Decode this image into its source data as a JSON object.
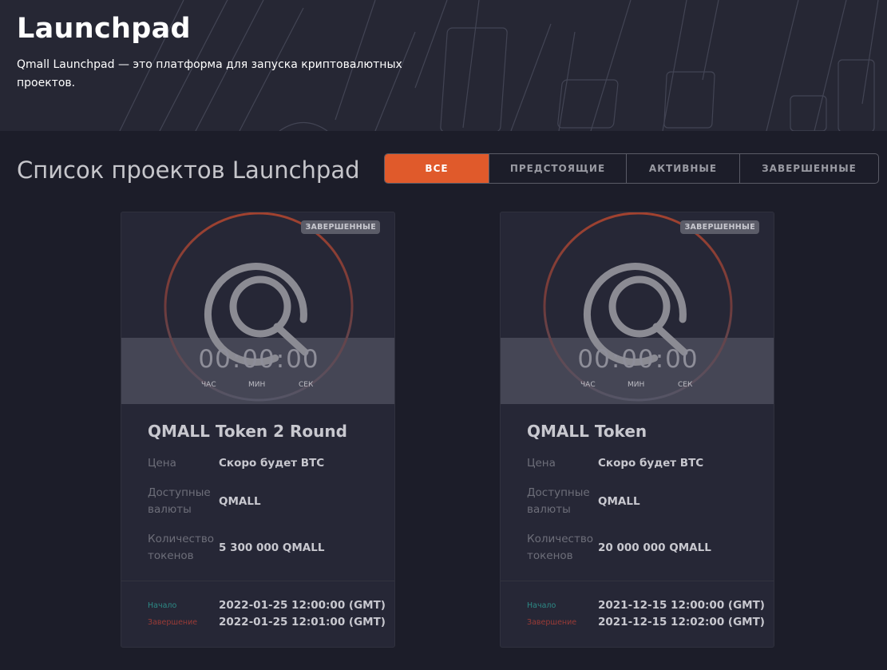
{
  "hero": {
    "title": "Launchpad",
    "subtitle": "Qmall Launchpad — это платформа для запуска криптовалютных проектов."
  },
  "section_title": "Список проектов Launchpad",
  "tabs": [
    {
      "label": "ВСЕ",
      "active": true
    },
    {
      "label": "ПРЕДСТОЯЩИЕ",
      "active": false
    },
    {
      "label": "АКТИВНЫЕ",
      "active": false
    },
    {
      "label": "ЗАВЕРШЕННЫЕ",
      "active": false
    }
  ],
  "colors": {
    "accent": "#e05a2b",
    "background": "#1c1d29",
    "card": "#262736",
    "start_label": "#2d8a86",
    "end_label": "#9a3b36"
  },
  "timer_labels": {
    "hours": "ЧАС",
    "minutes": "МИН",
    "seconds": "СЕК"
  },
  "field_labels": {
    "price": "Цена",
    "currencies": "Доступные валюты",
    "token_amount": "Количество токенов",
    "start": "Начало",
    "end": "Завершение"
  },
  "projects": [
    {
      "status": "ЗАВЕРШЕННЫЕ",
      "logo_icon": "qmall-logo-icon",
      "timer": {
        "hours": "00",
        "minutes": "00",
        "seconds": "00"
      },
      "name": "QMALL Token 2 Round",
      "price": "Скоро будет BTC",
      "currencies": "QMALL",
      "token_amount": "5 300 000 QMALL",
      "start": "2022-01-25 12:00:00 (GMT)",
      "end": "2022-01-25 12:01:00 (GMT)"
    },
    {
      "status": "ЗАВЕРШЕННЫЕ",
      "logo_icon": "qmall-logo-icon",
      "timer": {
        "hours": "00",
        "minutes": "00",
        "seconds": "00"
      },
      "name": "QMALL Token",
      "price": "Скоро будет BTC",
      "currencies": "QMALL",
      "token_amount": "20 000 000 QMALL",
      "start": "2021-12-15 12:00:00 (GMT)",
      "end": "2021-12-15 12:02:00 (GMT)"
    }
  ]
}
